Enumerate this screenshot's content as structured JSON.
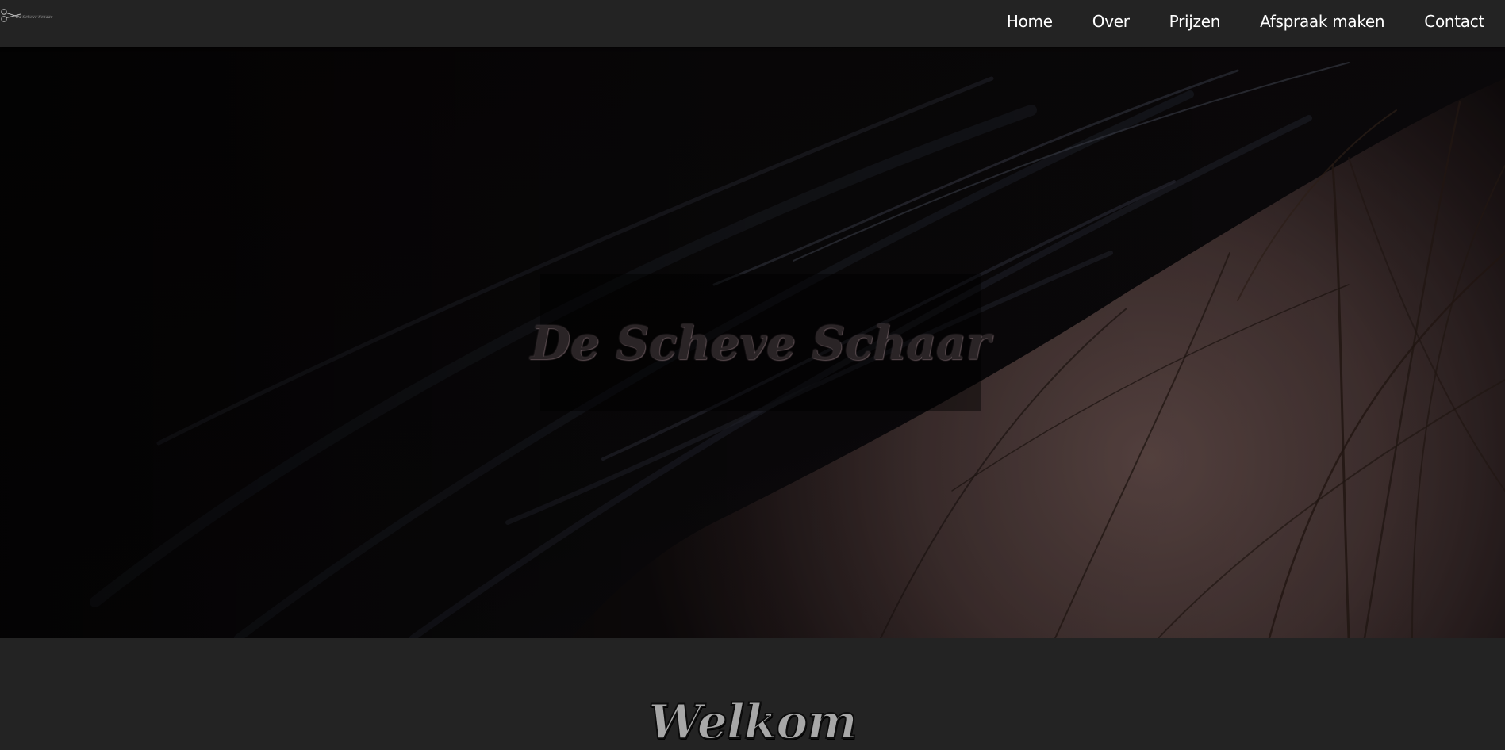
{
  "header": {
    "logo_text": "De Scheve Schaar",
    "nav": [
      {
        "label": "Home"
      },
      {
        "label": "Over"
      },
      {
        "label": "Prijzen"
      },
      {
        "label": "Afspraak maken"
      },
      {
        "label": "Contact"
      }
    ]
  },
  "hero": {
    "title": "De Scheve Schaar",
    "image_icon": "hair-photo"
  },
  "welcome": {
    "title": "Welkom"
  },
  "colors": {
    "background": "#232323",
    "nav_text": "#ffffff",
    "overlay": "rgba(0,0,0,0.45)"
  }
}
